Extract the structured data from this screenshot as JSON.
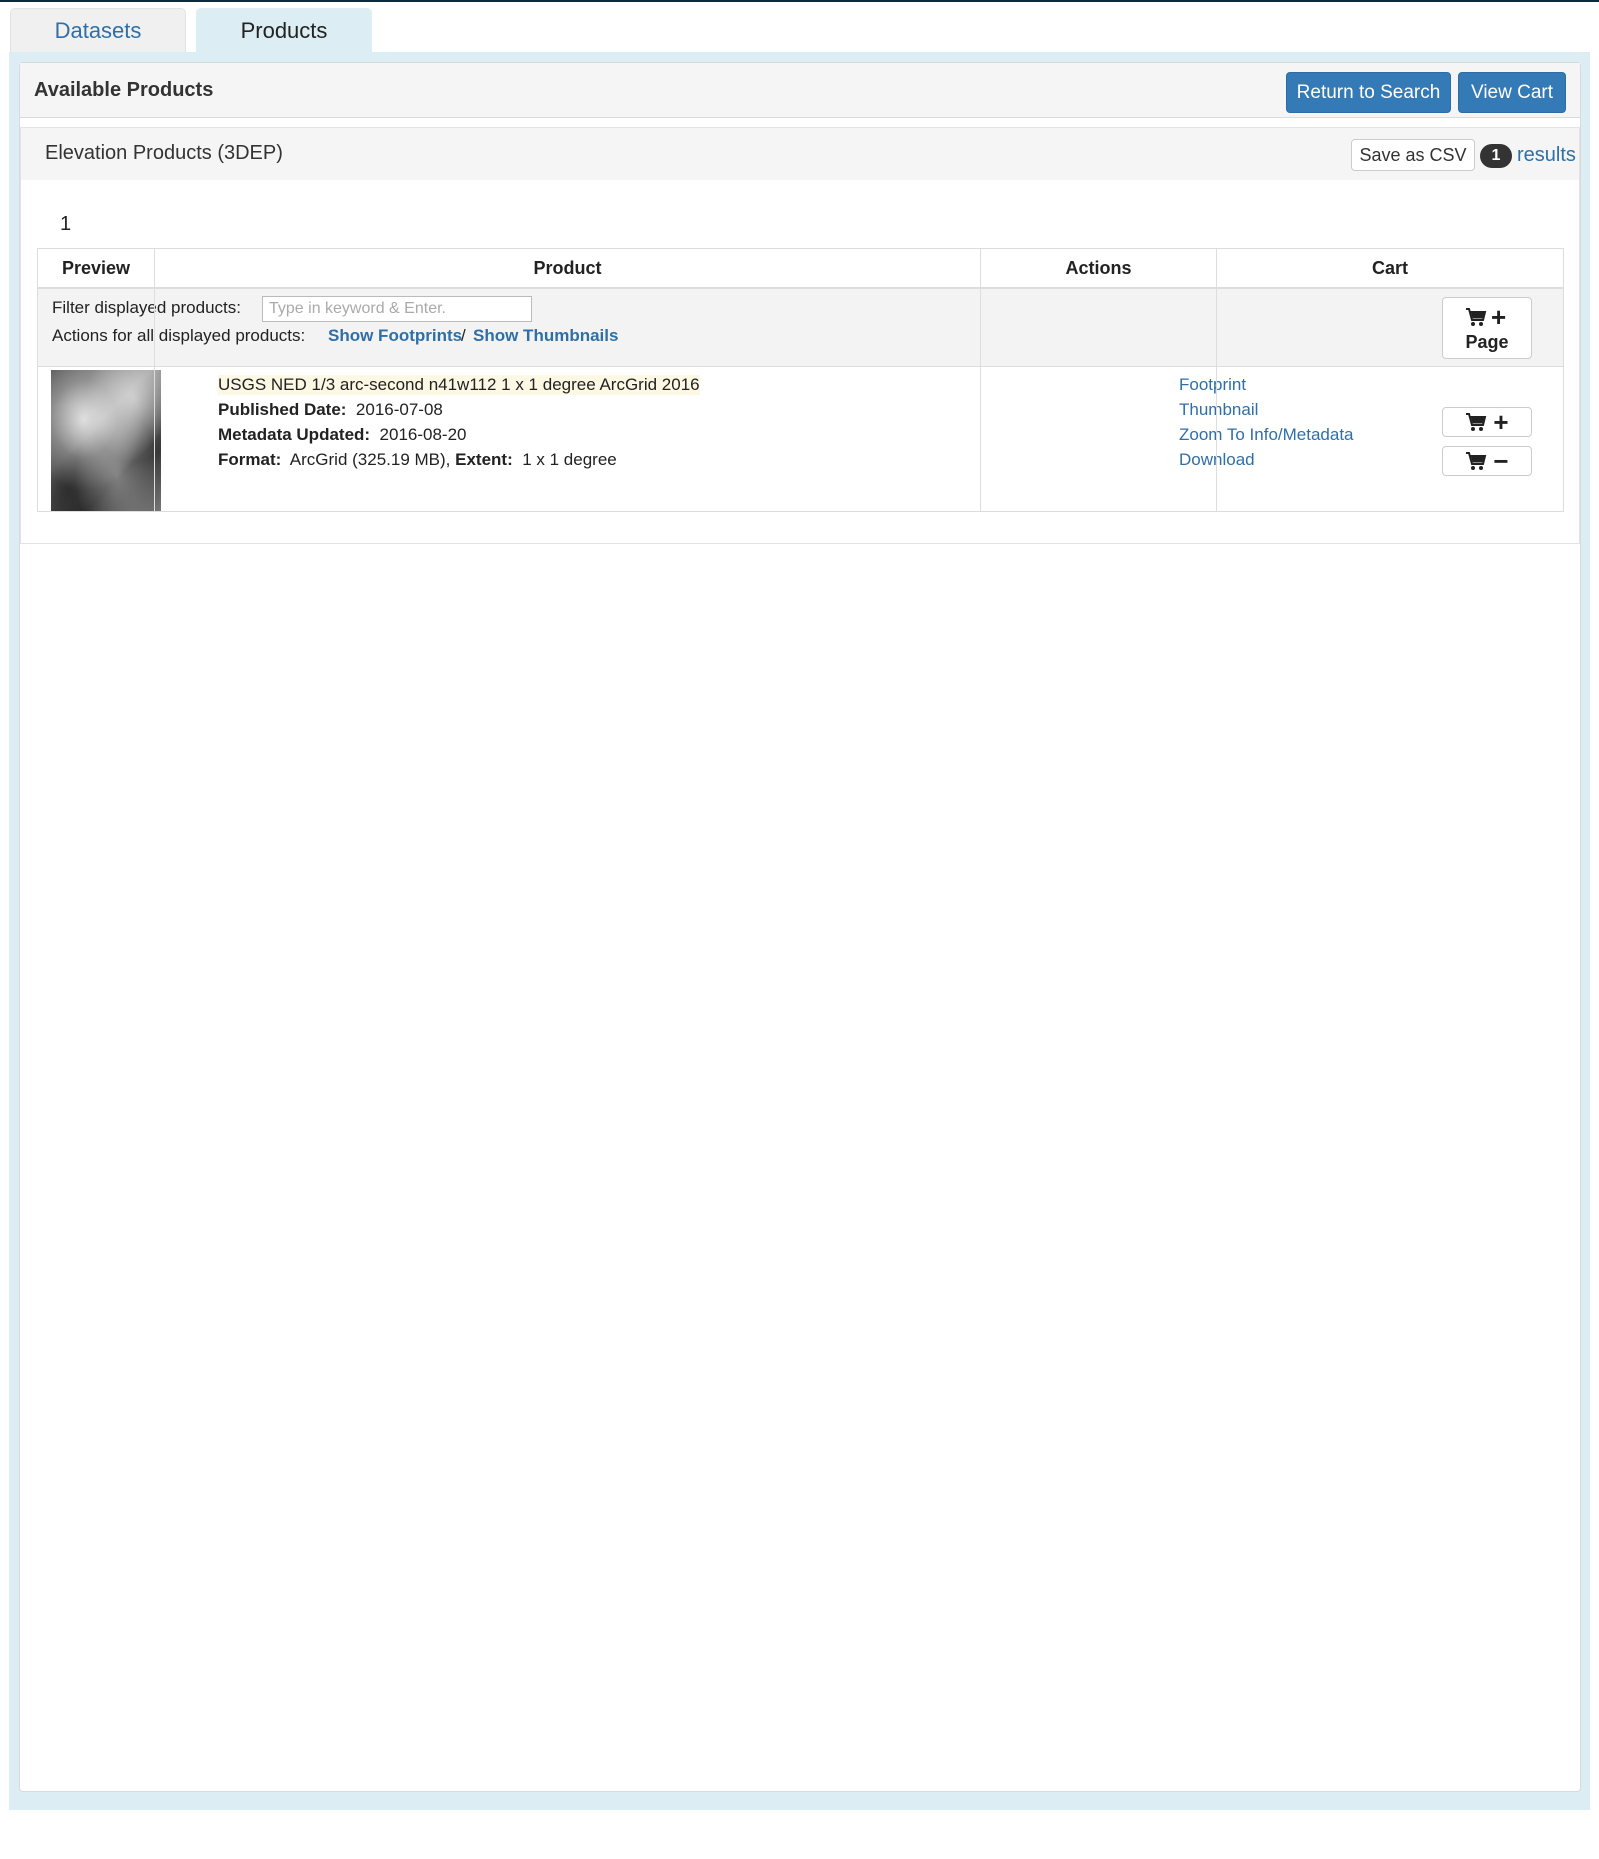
{
  "tabs": [
    {
      "label": "Datasets"
    },
    {
      "label": "Products"
    }
  ],
  "panel": {
    "title": "Available Products",
    "return_label": "Return to Search",
    "view_cart_label": "View Cart"
  },
  "section": {
    "title": "Elevation Products (3DEP)",
    "csv_label": "Save as CSV",
    "result_count": "1",
    "results_label": "results",
    "page_number": "1"
  },
  "table": {
    "headers": [
      "Preview",
      "Product",
      "Actions",
      "Cart"
    ],
    "filter_label": "Filter displayed products:",
    "filter_placeholder": "Type in keyword & Enter.",
    "actions_label": "Actions for all displayed products:",
    "show_footprints": "Show Footprints",
    "separator": "/",
    "show_thumbnails": "Show Thumbnails",
    "cart_page_label": "Page"
  },
  "product": {
    "title": "USGS NED 1/3 arc-second n41w112 1 x 1 degree ArcGrid 2016",
    "published_label": "Published Date:",
    "published_value": "2016-07-08",
    "metadata_label": "Metadata Updated:",
    "metadata_value": "2016-08-20",
    "format_label": "Format:",
    "format_value": "ArcGrid (325.19 MB),",
    "extent_label": "Extent:",
    "extent_value": "1 x 1 degree",
    "actions": [
      "Footprint",
      "Thumbnail",
      "Zoom To Info/Metadata",
      "Download"
    ]
  }
}
